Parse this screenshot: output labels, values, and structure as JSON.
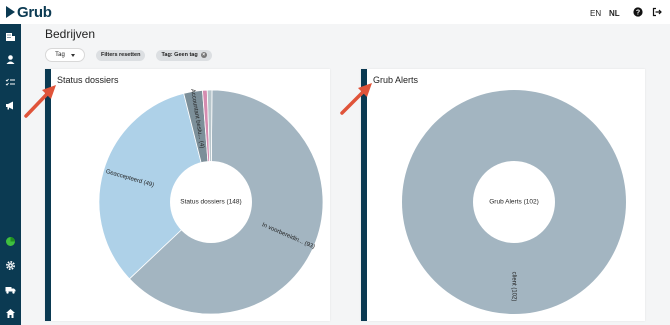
{
  "app": {
    "logo_text": "Grub"
  },
  "header": {
    "languages": [
      "EN",
      "NL"
    ],
    "active_language": "NL",
    "icons": [
      "help-icon",
      "logout-icon"
    ]
  },
  "sidebar": {
    "icons": [
      "companies-icon",
      "user-icon",
      "checklist-icon",
      "megaphone-icon",
      "pie-chart-icon",
      "gear-icon",
      "truck-icon",
      "home-icon"
    ]
  },
  "page": {
    "title": "Bedrijven"
  },
  "toolbar": {
    "tag_dropdown_label": "Tag",
    "reset_filters_label": "Filters resetten",
    "active_filter_label": "Tag: Geen tag"
  },
  "cards": [
    {
      "title": "Status dossiers",
      "center_label": "Status dossiers (148)",
      "slices": [
        {
          "label": "In voorbereidin... (93)",
          "value": 93,
          "color": "#a3b5c1"
        },
        {
          "label": "Geaccepteerd (49)",
          "value": 49,
          "color": "#aed1e8"
        },
        {
          "label": "Accountant beslu... (4)",
          "value": 4,
          "color": "#7c8f99"
        },
        {
          "label": "",
          "value": 1,
          "color": "#d58cb0"
        },
        {
          "label": "",
          "value": 1,
          "color": "#b8c6cc"
        }
      ]
    },
    {
      "title": "Grub Alerts",
      "center_label": "Grub Alerts (102)",
      "slices": [
        {
          "label": "client (102)",
          "value": 102,
          "color": "#a3b5c1"
        }
      ]
    }
  ],
  "colors": {
    "brand": "#0b3a52",
    "arrow": "#e0543a"
  }
}
